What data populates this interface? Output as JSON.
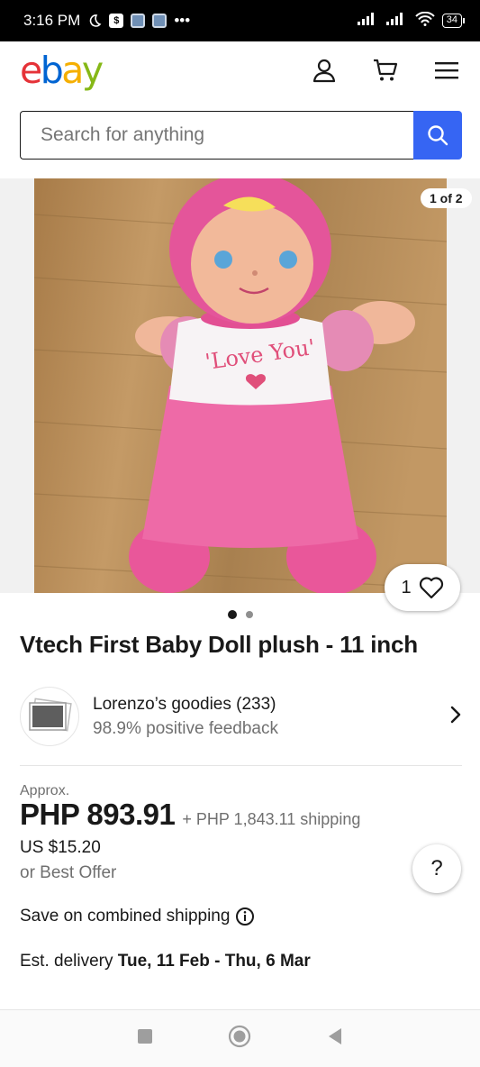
{
  "status_bar": {
    "time": "3:16 PM",
    "battery": "34",
    "more": "•••",
    "app_badge": "$"
  },
  "header": {
    "logo": {
      "e": "e",
      "b": "b",
      "a": "a",
      "y": "y"
    },
    "icons": [
      "user-icon",
      "cart-icon",
      "menu-icon"
    ]
  },
  "search": {
    "placeholder": "Search for anything"
  },
  "gallery": {
    "counter": "1 of 2",
    "watch_count": "1",
    "current_image": 1,
    "total_images": 2
  },
  "listing": {
    "title": "Vtech First Baby Doll plush - 11 inch"
  },
  "seller": {
    "name": "Lorenzo’s goodies (233)",
    "feedback": "98.9% positive feedback"
  },
  "price": {
    "approx_label": "Approx.",
    "amount": "PHP 893.91",
    "shipping": "+ PHP 1,843.11 shipping",
    "usd": "US $15.20",
    "best_offer": "or Best Offer"
  },
  "help": {
    "label": "?"
  },
  "combined_shipping": "Save on combined shipping",
  "delivery": {
    "label": "Est. delivery ",
    "dates": "Tue, 11 Feb - Thu, 6 Mar"
  },
  "colors": {
    "brand_blue": "#3665f3",
    "text": "#191919",
    "muted": "#707070"
  }
}
